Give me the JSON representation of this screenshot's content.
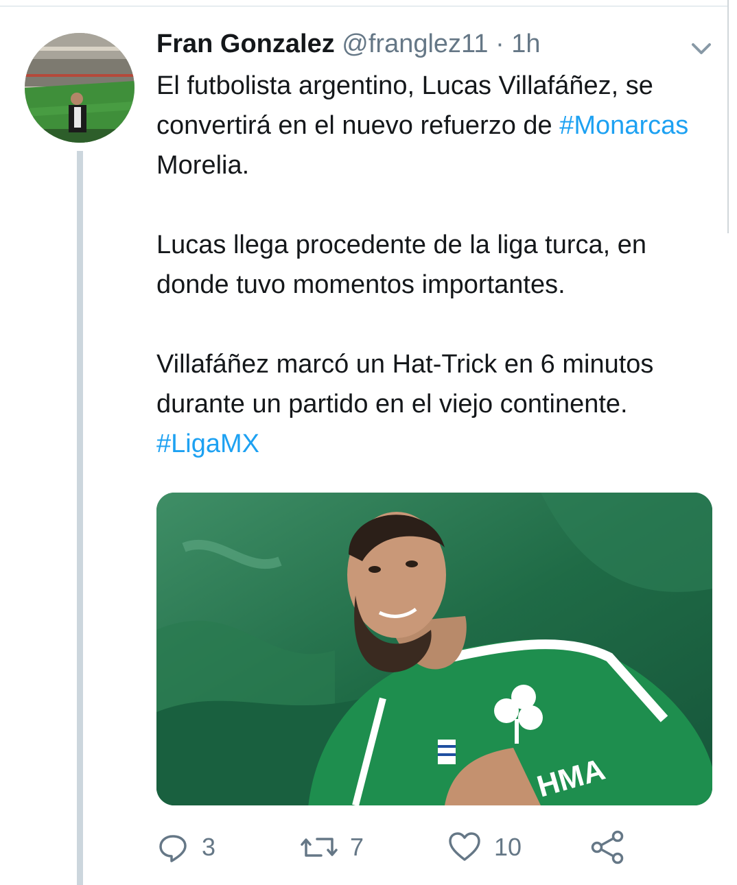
{
  "tweet": {
    "author_name": "Fran Gonzalez",
    "handle": "@franglez11",
    "separator": "·",
    "time": "1h",
    "text_parts": [
      "El futbolista argentino, Lucas Villafáñez, se convertirá en el nuevo refuerzo de ",
      "#Monarcas",
      " Morelia.\n\nLucas llega procedente de la liga turca, en donde tuvo momentos importantes.\n\nVillafáñez marcó un Hat-Trick en 6 minutos durante un partido en el viejo continente. ",
      "#LigaMX"
    ],
    "image_text": "HMA"
  },
  "actions": {
    "reply_count": "3",
    "retweet_count": "7",
    "like_count": "10"
  },
  "icons": {
    "menu": "chevron-down-icon",
    "reply": "reply-icon",
    "retweet": "retweet-icon",
    "like": "heart-icon",
    "share": "share-icon"
  },
  "colors": {
    "text": "#14171a",
    "muted": "#657786",
    "hashtag": "#1da1f2",
    "thread_line": "#ccd6dd"
  }
}
